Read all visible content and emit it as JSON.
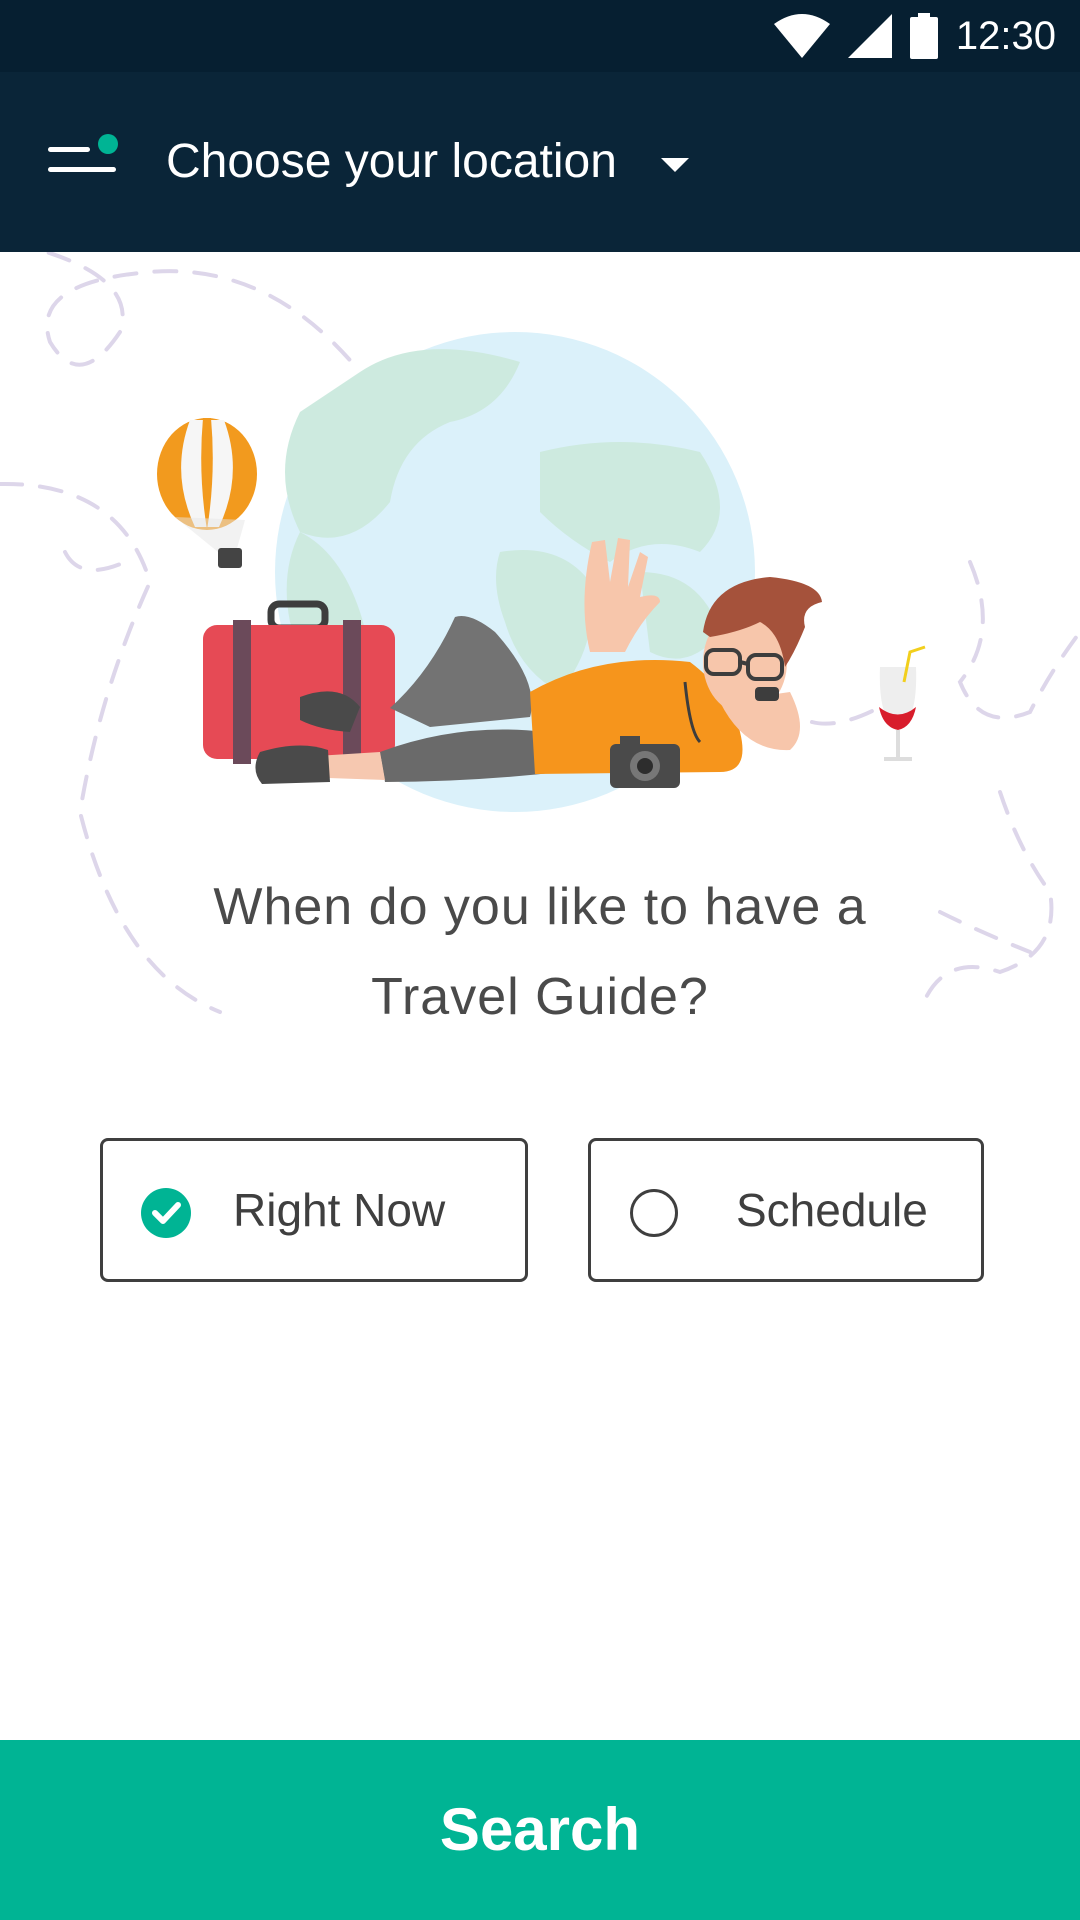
{
  "status_bar": {
    "time": "12:30",
    "icons": [
      "wifi-icon",
      "cellular-signal-icon",
      "battery-icon"
    ]
  },
  "app_bar": {
    "menu_icon": "menu-notification-icon",
    "location_label": "Choose your location",
    "dropdown_icon": "caret-down-icon"
  },
  "hero": {
    "illustration": "traveler-relaxing-globe-illustration"
  },
  "question": {
    "line1": "When do you like to have a",
    "line2": "Travel Guide?"
  },
  "options": [
    {
      "label": "Right Now",
      "selected": true
    },
    {
      "label": "Schedule",
      "selected": false
    }
  ],
  "search_button": {
    "label": "Search"
  },
  "colors": {
    "status_bar": "#061f31",
    "app_bar": "#0a2538",
    "accent": "#00b494",
    "text_dark": "#3f3f3f"
  }
}
